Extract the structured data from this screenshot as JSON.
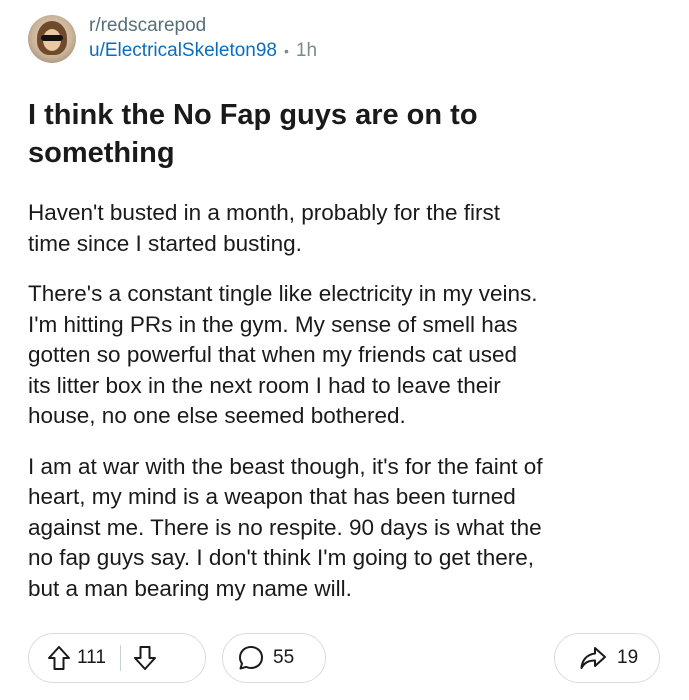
{
  "post": {
    "subreddit": "r/redscarepod",
    "username": "u/ElectricalSkeleton98",
    "separator": "•",
    "time": "1h",
    "title": "I think the No Fap guys are on to something",
    "paragraphs": [
      "Haven't busted in a month, probably for the first\ntime since I started busting.",
      "There's a constant tingle like electricity in my veins.\nI'm hitting PRs in the gym. My sense of smell has\ngotten so powerful that when my friends cat used\nits litter box in the next room I had to leave their\nhouse, no one else seemed bothered.",
      "I am at war with the beast though, it's for the faint of\nheart, my mind is a weapon that has been turned\nagainst me. There is no respite. 90 days is what the\nno fap guys say. I don't think I'm going to get there,\nbut a man bearing my name will."
    ]
  },
  "actions": {
    "upvote_icon": "upvote-arrow-icon",
    "downvote_icon": "downvote-arrow-icon",
    "comment_icon": "comment-bubble-icon",
    "share_icon": "share-arrow-icon",
    "vote_count": "111",
    "comment_count": "55",
    "share_count": "19"
  },
  "colors": {
    "username": "#0a6ebd",
    "subreddit": "#576f76",
    "text": "#1a1a1b",
    "pill_border": "#d7dde0"
  }
}
